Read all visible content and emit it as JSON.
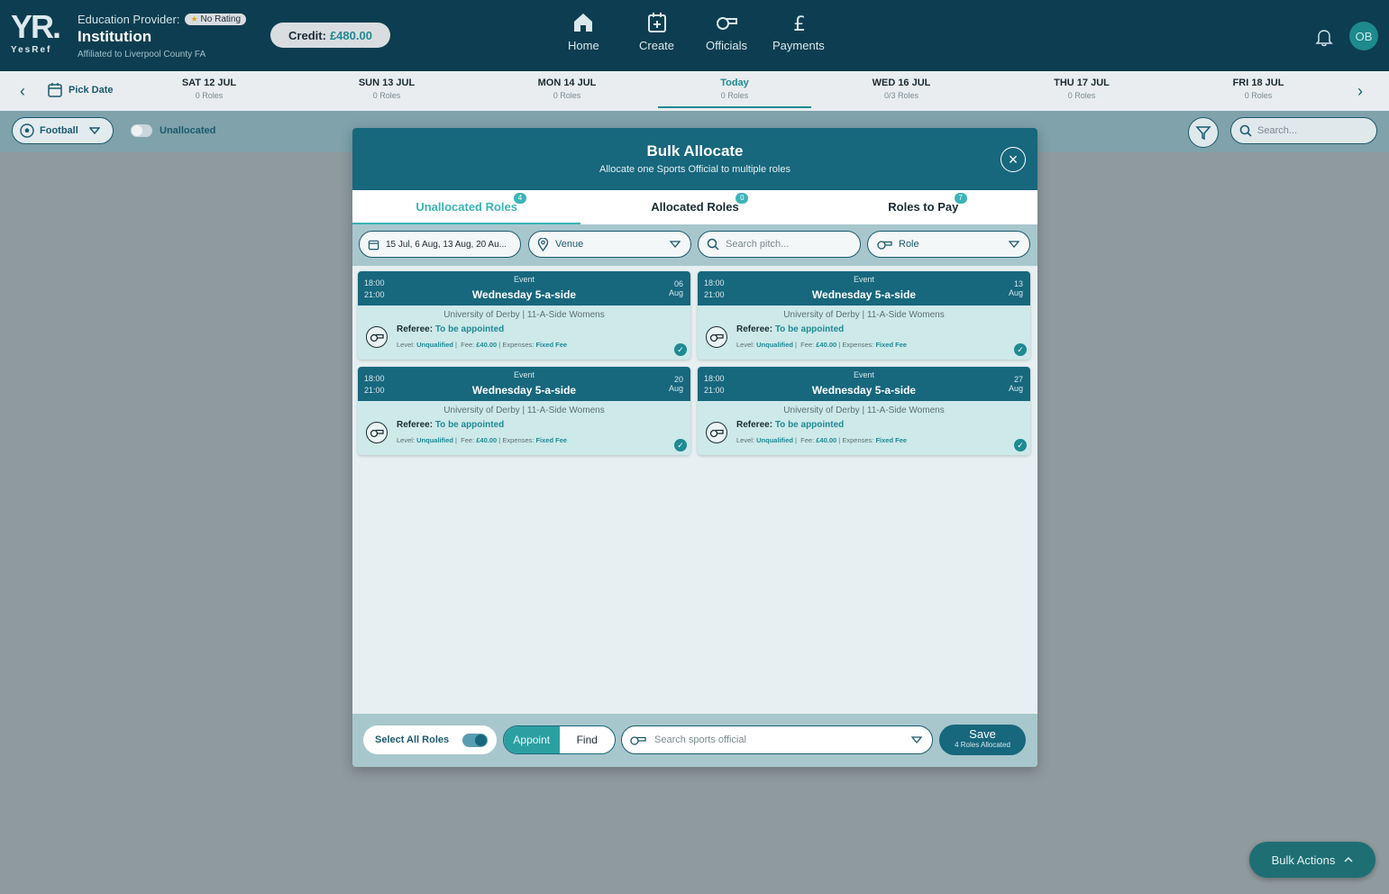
{
  "brand": {
    "logo_big": "YR.",
    "logo_small": "YesRef"
  },
  "provider": {
    "label": "Education Provider:",
    "rating": "No Rating",
    "name": "Institution",
    "affiliation": "Affiliated to Liverpool County FA"
  },
  "credit": {
    "label": "Credit:",
    "amount": "£480.00"
  },
  "nav": [
    {
      "label": "Home"
    },
    {
      "label": "Create"
    },
    {
      "label": "Officials"
    },
    {
      "label": "Payments"
    }
  ],
  "user": {
    "initials": "OB"
  },
  "datebar": {
    "pick_label": "Pick Date",
    "days": [
      {
        "day": "SAT 12 JUL",
        "roles": "0 Roles"
      },
      {
        "day": "SUN 13 JUL",
        "roles": "0 Roles"
      },
      {
        "day": "MON 14 JUL",
        "roles": "0 Roles"
      },
      {
        "day": "Today",
        "roles": "0 Roles"
      },
      {
        "day": "WED 16 JUL",
        "roles": "0/3 Roles"
      },
      {
        "day": "THU 17 JUL",
        "roles": "0 Roles"
      },
      {
        "day": "FRI 18 JUL",
        "roles": "0 Roles"
      }
    ]
  },
  "filters": {
    "sport": "Football",
    "unallocated_label": "Unallocated",
    "search_placeholder": "Search..."
  },
  "modal": {
    "title": "Bulk Allocate",
    "subtitle": "Allocate one Sports Official to multiple roles",
    "tabs": [
      {
        "label": "Unallocated Roles",
        "count": "4"
      },
      {
        "label": "Allocated Roles",
        "count": "0"
      },
      {
        "label": "Roles to Pay",
        "count": "7"
      }
    ],
    "date_filter": "15 Jul, 6 Aug, 13 Aug, 20 Au...",
    "venue_placeholder": "Venue",
    "pitch_placeholder": "Search pitch...",
    "role_placeholder": "Role",
    "cards": [
      {
        "start": "18:00",
        "end": "21:00",
        "type": "Event",
        "name": "Wednesday 5-a-side",
        "day": "06",
        "month": "Aug",
        "venue": "University of Derby | 11-A-Side Womens",
        "role": "Referee:",
        "status": "To be appointed",
        "level_label": "Level:",
        "level": "Unqualified",
        "fee_label": "Fee:",
        "fee": "£40.00",
        "exp_label": "Expenses:",
        "expenses": "Fixed Fee"
      },
      {
        "start": "18:00",
        "end": "21:00",
        "type": "Event",
        "name": "Wednesday 5-a-side",
        "day": "13",
        "month": "Aug",
        "venue": "University of Derby | 11-A-Side Womens",
        "role": "Referee:",
        "status": "To be appointed",
        "level_label": "Level:",
        "level": "Unqualified",
        "fee_label": "Fee:",
        "fee": "£40.00",
        "exp_label": "Expenses:",
        "expenses": "Fixed Fee"
      },
      {
        "start": "18:00",
        "end": "21:00",
        "type": "Event",
        "name": "Wednesday 5-a-side",
        "day": "20",
        "month": "Aug",
        "venue": "University of Derby | 11-A-Side Womens",
        "role": "Referee:",
        "status": "To be appointed",
        "level_label": "Level:",
        "level": "Unqualified",
        "fee_label": "Fee:",
        "fee": "£40.00",
        "exp_label": "Expenses:",
        "expenses": "Fixed Fee"
      },
      {
        "start": "18:00",
        "end": "21:00",
        "type": "Event",
        "name": "Wednesday 5-a-side",
        "day": "27",
        "month": "Aug",
        "venue": "University of Derby | 11-A-Side Womens",
        "role": "Referee:",
        "status": "To be appointed",
        "level_label": "Level:",
        "level": "Unqualified",
        "fee_label": "Fee:",
        "fee": "£40.00",
        "exp_label": "Expenses:",
        "expenses": "Fixed Fee"
      }
    ],
    "footer": {
      "select_all": "Select All Roles",
      "appoint": "Appoint",
      "find": "Find",
      "official_placeholder": "Search sports official",
      "save": "Save",
      "save_sub": "4 Roles Allocated"
    }
  },
  "bulk_actions": "Bulk Actions",
  "colors": {
    "header": "#0d3d50",
    "modal_head": "#17677d",
    "accent": "#2ba0a3"
  }
}
